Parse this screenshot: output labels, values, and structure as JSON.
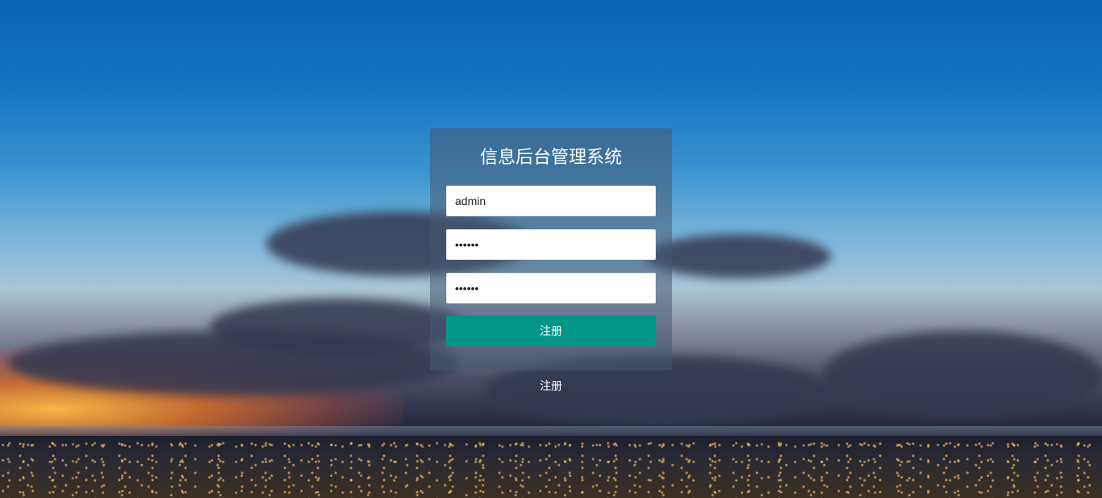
{
  "page": {
    "title": "信息后台管理系统"
  },
  "form": {
    "username_value": "admin",
    "password_value": "••••••",
    "confirm_password_value": "••••••",
    "submit_label": "注册"
  },
  "footer": {
    "register_link": "注册"
  },
  "colors": {
    "submit_button": "#009688",
    "panel": "rgba(70,90,115,0.55)"
  },
  "background": {
    "image_semantic": "city-skyline-at-sunset-background"
  }
}
